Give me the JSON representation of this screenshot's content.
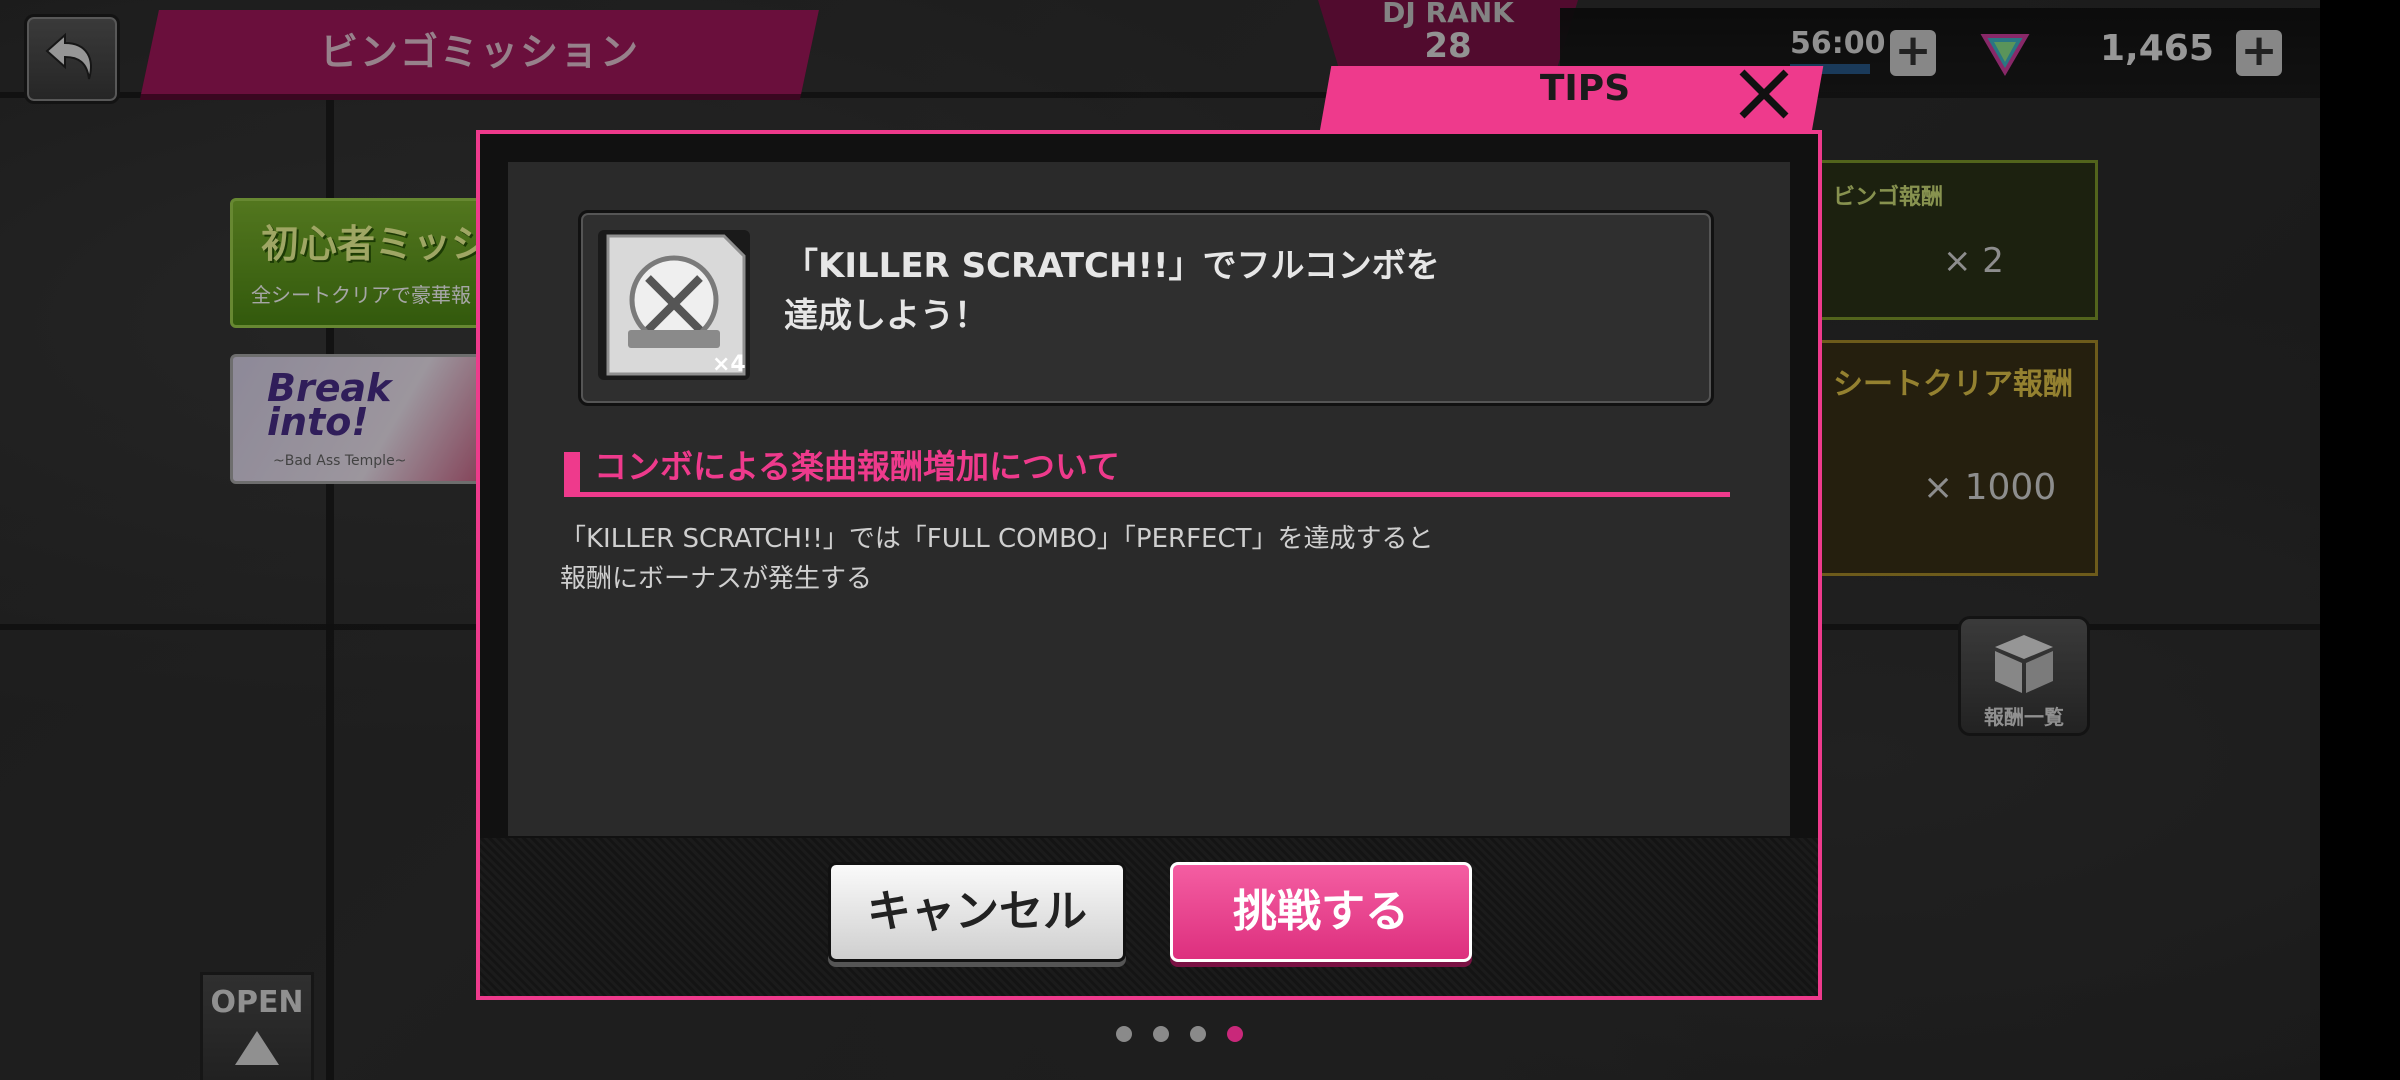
{
  "header": {
    "title": "ビンゴミッション",
    "dj_rank_label": "DJ RANK",
    "dj_rank_value": "28",
    "stamina_text": "56:00",
    "gem_count": "1,465"
  },
  "left_banners": {
    "beginner_title": "初心者ミッシ",
    "beginner_sub": "全シートクリアで豪華報",
    "break_title": "Break into!",
    "break_sub": "~Bad Ass Temple~"
  },
  "right_panels": {
    "bingo_reward_header": "ビンゴ報酬",
    "bingo_reward_count": "× 2",
    "sheet_reward_header": "シートクリア報酬",
    "sheet_reward_count": "× 1000",
    "reward_list_label": "報酬一覧"
  },
  "open_button": {
    "label": "OPEN"
  },
  "dialog": {
    "tab_label": "TIPS",
    "badge_count": "×4",
    "mission_line1": "「KILLER SCRATCH!!」でフルコンボを",
    "mission_line2": "達成しよう！",
    "section_title": "コンボによる楽曲報酬増加について",
    "desc_line1": "「KILLER SCRATCH!!」では「FULL COMBO」「PERFECT」を達成すると",
    "desc_line2": "報酬にボーナスが発生する",
    "cancel_label": "キャンセル",
    "challenge_label": "挑戦する"
  },
  "pagination": {
    "count": 4,
    "active_index": 3
  },
  "colors": {
    "accent": "#ee3a8c",
    "banner": "#a3185c"
  }
}
